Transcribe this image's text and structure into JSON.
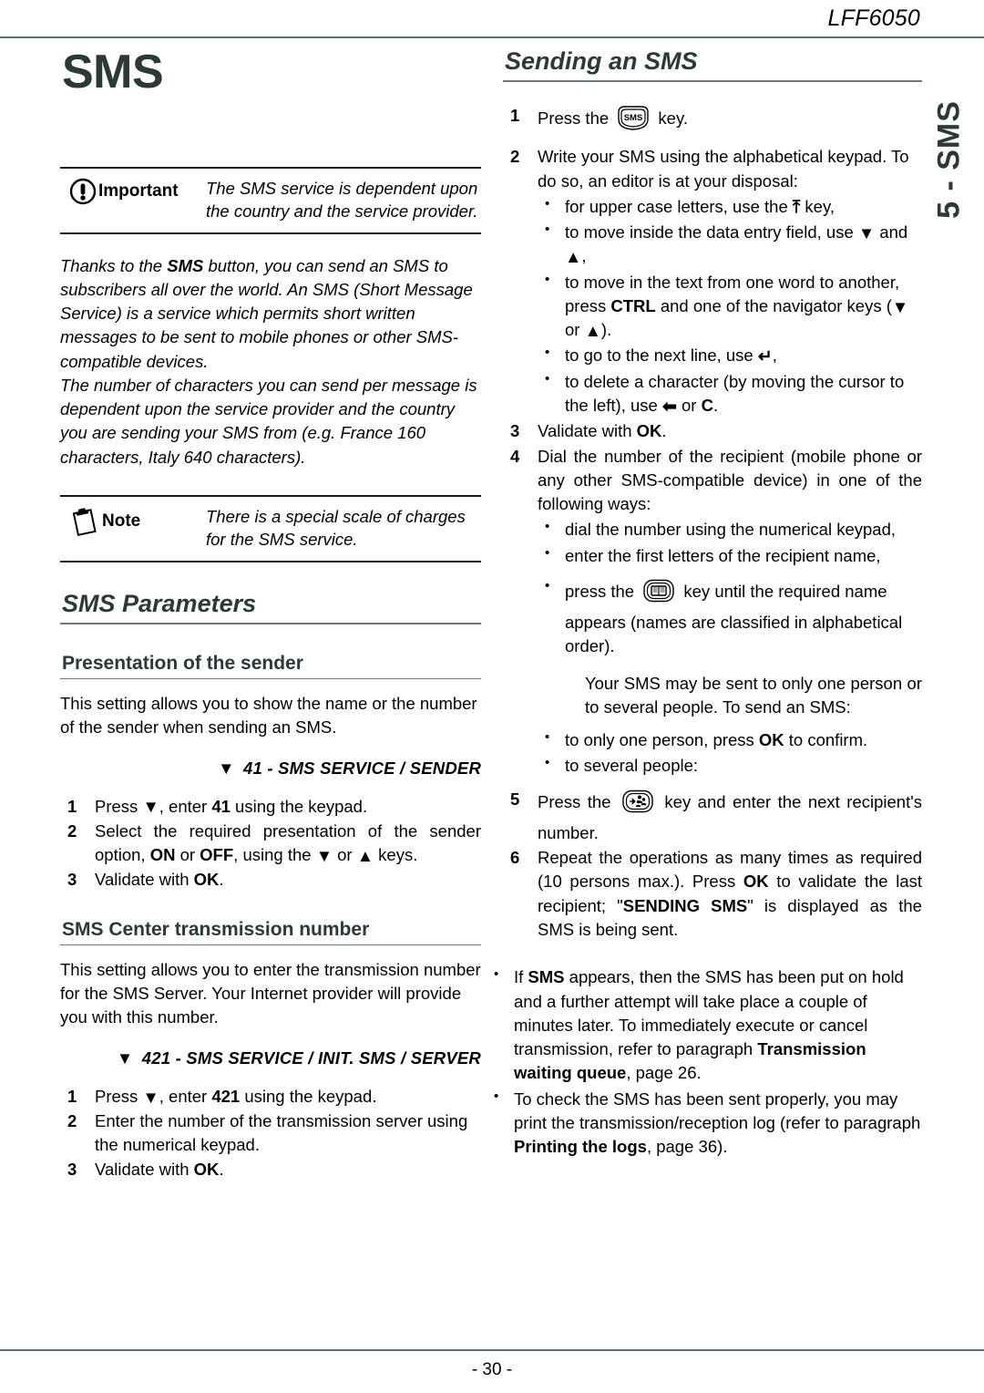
{
  "header": {
    "model": "LFF6050"
  },
  "side_tab": {
    "label": "5 - SMS"
  },
  "footer": {
    "page_number": "- 30 -"
  },
  "colors": {
    "heading": "#2b3a38",
    "rule": "#5d6f6d",
    "text": "#000000"
  },
  "left_column": {
    "doc_title": "SMS",
    "important_callout": {
      "icon": "exclamation-circle-icon",
      "label": "Important",
      "text": "The SMS service is dependent upon the country and the service provider."
    },
    "intro_paragraph_1": {
      "part1": "Thanks to the ",
      "bold1": "SMS",
      "part2": " button, you can send an SMS to subscribers all over the world. An SMS (Short Message Service) is a service which permits short written messages to be sent to mobile phones or other SMS-compatible devices."
    },
    "intro_paragraph_2": "The number of characters you can send per message is dependent upon the service provider and the country you are sending your SMS from (e.g. France 160 characters, Italy 640 characters).",
    "note_callout": {
      "icon": "clipboard-icon",
      "label": "Note",
      "text": "There is a special scale of charges for the SMS service."
    },
    "section_title": "SMS Parameters",
    "subsection_1": {
      "title": "Presentation of the sender",
      "paragraph": "This setting allows you to show the name or the number of the sender when sending an SMS.",
      "menu_path": "41 - SMS SERVICE / SENDER",
      "steps": [
        {
          "num": "1",
          "pre": "Press ",
          "mid": ", enter ",
          "bold": "41",
          "post": " using the keypad."
        },
        {
          "num": "2",
          "pre": "Select the required presentation of the sender option, ",
          "bold_a": "ON",
          "mid_a": " or ",
          "bold_b": "OFF",
          "mid_b": ", using the ",
          "mid_c": " or ",
          "post": " keys."
        },
        {
          "num": "3",
          "pre": "Validate with ",
          "bold": "OK",
          "post": "."
        }
      ]
    },
    "subsection_2": {
      "title": "SMS Center transmission number",
      "paragraph": "This setting allows you to enter the transmission number for the SMS Server. Your Internet provider will provide you with this number.",
      "menu_path": "421 - SMS SERVICE / INIT. SMS / SERVER",
      "steps": [
        {
          "num": "1",
          "pre": "Press ",
          "mid": ", enter ",
          "bold": "421",
          "post": " using the keypad."
        },
        {
          "num": "2",
          "text": "Enter the number of the transmission server using the numerical keypad."
        },
        {
          "num": "3",
          "pre": "Validate with ",
          "bold": "OK",
          "post": "."
        }
      ]
    }
  },
  "right_column": {
    "section_title": "Sending an SMS",
    "step1": {
      "num": "1",
      "pre": "Press the ",
      "key_icon": "sms-key-icon",
      "key_label": "SMS",
      "post": " key."
    },
    "step2": {
      "num": "2",
      "text": "Write your SMS using the alphabetical keypad. To do so, an editor is at your disposal:",
      "bullets": [
        {
          "pre": "for upper case letters, use the ",
          "glyph": "arrow-up-bold-icon",
          "post": " key,"
        },
        {
          "pre": "to move inside the data entry field, use ",
          "glyph": "triangle-down-icon",
          "mid": " and ",
          "glyph2": "triangle-up-icon",
          "post": ","
        },
        {
          "pre": "to move in the text from one word to another, press ",
          "bold": "CTRL",
          "mid": " and one of the navigator keys (",
          "glyph": "triangle-down-icon",
          "mid2": " or ",
          "glyph2": "triangle-up-icon",
          "post": ")."
        },
        {
          "pre": "to go to the next line, use ",
          "glyph": "enter-key-icon",
          "post": ","
        },
        {
          "pre": "to delete a character (by moving the cursor to the left), use ",
          "glyph": "arrow-left-bold-icon",
          "mid": " or ",
          "bold": "C",
          "post": "."
        }
      ]
    },
    "step3": {
      "num": "3",
      "pre": "Validate with ",
      "bold": "OK",
      "post": "."
    },
    "step4": {
      "num": "4",
      "text": "Dial the number of the recipient (mobile phone or any other SMS-compatible device) in one of the following ways:",
      "bullets": [
        {
          "text": "dial the number using the numerical keypad,"
        },
        {
          "text": "enter the first letters of the recipient name,"
        },
        {
          "pre": "press the ",
          "key_icon": "directory-book-key-icon",
          "post": " key until the required name appears (names are classified in alphabetical order)."
        }
      ],
      "note": "Your SMS may be sent to only one person or to several people. To send an SMS:",
      "bullets2": [
        {
          "pre": "to only one person, press ",
          "bold": "OK",
          "post": " to confirm."
        },
        {
          "text": "to several people:"
        }
      ]
    },
    "step5": {
      "num": "5",
      "pre": "Press the ",
      "key_icon": "multi-contact-key-icon",
      "post": " key and enter the next recipient's number."
    },
    "step6": {
      "num": "6",
      "pre": "Repeat the operations as many times as required (10 persons max.). Press ",
      "bold_a": "OK",
      "mid": " to validate the last recipient; \"",
      "bold_b": "SENDING SMS",
      "post": "\" is displayed as the SMS is being sent."
    },
    "final_bullets": [
      {
        "pre": "If ",
        "bold_a": "SMS",
        "mid": " appears, then the SMS has been put on hold and a further attempt will take place a couple of minutes later. To immediately execute or cancel transmission, refer to paragraph ",
        "bold_b": "Transmission waiting queue",
        "post": ", page 26."
      },
      {
        "pre": "To check the SMS has been sent properly, you may print the transmission/reception log (refer to paragraph ",
        "bold_b": "Printing the logs",
        "post": ", page 36)."
      }
    ]
  }
}
